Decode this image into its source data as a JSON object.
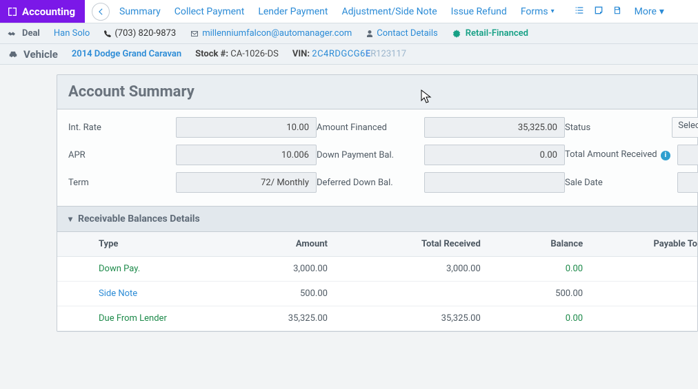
{
  "brand": "Accounting",
  "nav": {
    "links": [
      "Summary",
      "Collect Payment",
      "Lender Payment",
      "Adjustment/Side Note",
      "Issue Refund"
    ],
    "forms": "Forms",
    "more": "More"
  },
  "deal": {
    "label": "Deal",
    "customer": "Han Solo",
    "phone": "(703) 820-9873",
    "email": "millenniumfalcon@automanager.com",
    "contact": "Contact Details",
    "retail": "Retail-Financed"
  },
  "vehicle": {
    "label": "Vehicle",
    "name": "2014 Dodge Grand Caravan",
    "stock_label": "Stock #:",
    "stock": "CA-1026-DS",
    "vin_label": "VIN:",
    "vin_a": "2C4RDGCG6",
    "vin_b": "E",
    "vin_c": "R123117"
  },
  "summary": {
    "title": "Account Summary",
    "rows": {
      "int_rate": {
        "label": "Int. Rate",
        "value": "10.00"
      },
      "apr": {
        "label": "APR",
        "value": "10.006"
      },
      "term": {
        "label": "Term",
        "value": "72/ Monthly"
      },
      "amt_fin": {
        "label": "Amount Financed",
        "value": "35,325.00"
      },
      "down_bal": {
        "label": "Down Payment Bal.",
        "value": "0.00"
      },
      "def_down": {
        "label": "Deferred Down Bal.",
        "value": ""
      },
      "status": {
        "label": "Status",
        "value": "Select"
      },
      "total_recv": {
        "label": "Total Amount Received",
        "value": ""
      },
      "sale_date": {
        "label": "Sale Date",
        "value": ""
      }
    }
  },
  "receivables": {
    "header": "Receivable Balances Details",
    "columns": {
      "type": "Type",
      "amount": "Amount",
      "total": "Total Received",
      "balance": "Balance",
      "payto": "Payable To"
    },
    "rows": [
      {
        "type": "Down Pay.",
        "t_green": true,
        "amount": "3,000.00",
        "total": "3,000.00",
        "balance": "0.00",
        "b_green": true
      },
      {
        "type": "Side Note",
        "t_link": true,
        "amount": "500.00",
        "total": "",
        "balance": "500.00",
        "b_green": false
      },
      {
        "type": "Due From Lender",
        "t_green": true,
        "amount": "35,325.00",
        "total": "35,325.00",
        "balance": "0.00",
        "b_green": true
      }
    ]
  }
}
